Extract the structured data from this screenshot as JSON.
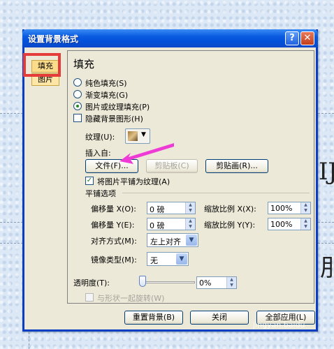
{
  "dialog": {
    "title": "设置背景格式",
    "help_icon": "?",
    "close_icon": "✕"
  },
  "nav": {
    "items": [
      {
        "label": "填充"
      },
      {
        "label": "图片"
      }
    ]
  },
  "fill": {
    "heading": "填充",
    "options": [
      {
        "label": "纯色填充(S)",
        "checked": false
      },
      {
        "label": "渐变填充(G)",
        "checked": false
      },
      {
        "label": "图片或纹理填充(P)",
        "checked": true
      }
    ],
    "hide_bg_graphics": "隐藏背景图形(H)",
    "texture_label": "纹理(U):",
    "insert_from": "插入自:",
    "file_button": "文件(F)...",
    "clipboard_button": "剪贴板(C)",
    "clipart_button": "剪贴画(R)...",
    "tile_checkbox": "将图片平铺为纹理(A)",
    "tile_options_heading": "平铺选项",
    "offset_x_label": "偏移量 X(O):",
    "offset_x_value": "0 磅",
    "scale_x_label": "缩放比例 X(X):",
    "scale_x_value": "100%",
    "offset_y_label": "偏移量 Y(E):",
    "offset_y_value": "0 磅",
    "scale_y_label": "缩放比例 Y(Y):",
    "scale_y_value": "100%",
    "align_label": "对齐方式(M):",
    "align_value": "左上对齐",
    "mirror_label": "镜像类型(M):",
    "mirror_value": "无",
    "transparency_label": "透明度(T):",
    "transparency_value": "0%",
    "transparency_level": 0,
    "rotate_with_shape": "与形状一起旋转(W)"
  },
  "footer": {
    "reset_button": "重置背景(B)",
    "close_button": "关闭",
    "apply_all_button": "全部应用(L)"
  },
  "slide": {
    "char_top": "IJ",
    "char_bottom": "刖"
  },
  "watermark": "jingyan.baidu"
}
